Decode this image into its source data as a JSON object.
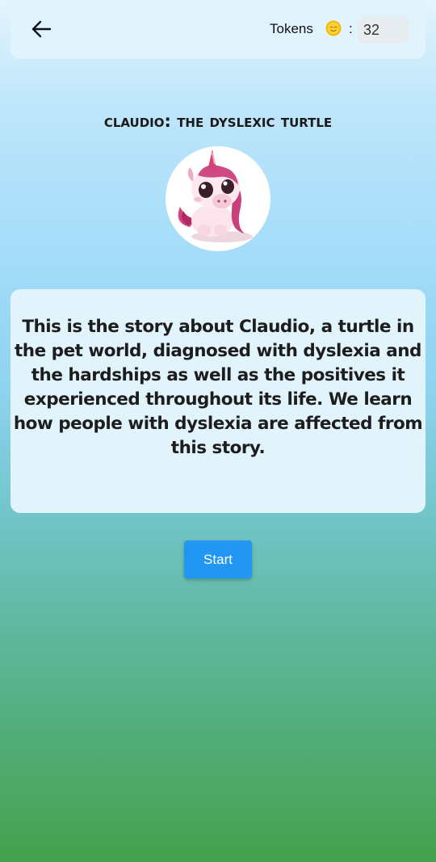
{
  "header": {
    "back_icon": "arrow-left-icon",
    "tokens_label": "Tokens",
    "coin_icon": "coin-icon",
    "separator": ":",
    "token_count": "32"
  },
  "story": {
    "title": "Claudio: The Dyslexic Turtle",
    "avatar_icon": "unicorn-avatar",
    "description": "This is the story about Claudio, a turtle in the pet world, diagnosed with dyslexia and the hardships as well as the positives it experienced throughout its life.  We learn how people with dyslexia are affected from this story."
  },
  "actions": {
    "start_label": "Start"
  },
  "colors": {
    "accent": "#2196f3",
    "card_background": "#e1f4fc",
    "gradient_top": "#e3f4fd",
    "gradient_bottom": "#44a14c"
  }
}
